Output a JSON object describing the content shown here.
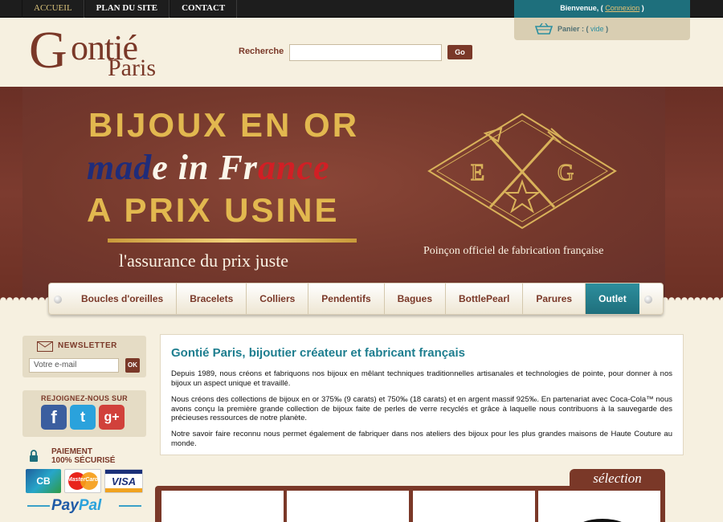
{
  "topnav": {
    "items": [
      {
        "label": "ACCUEIL",
        "active": true
      },
      {
        "label": "PLAN DU SITE",
        "active": false
      },
      {
        "label": "CONTACT",
        "active": false
      }
    ]
  },
  "account": {
    "welcome_prefix": "Bienvenue, (",
    "login_link": "Connexion",
    "welcome_suffix": ")",
    "cart_label": "Panier : (",
    "cart_status": "vide",
    "cart_suffix": ")"
  },
  "logo": {
    "g": "G",
    "ontie": "ontié",
    "paris": "Paris"
  },
  "search": {
    "label": "Recherche",
    "value": "",
    "button": "Go"
  },
  "banner": {
    "line1": "BIJOUX EN OR",
    "line2_part1": "mad",
    "line2_part2": "e in Fr",
    "line2_part3": "ance",
    "line3": "A PRIX USINE",
    "tagline": "l'assurance du prix juste",
    "poincon_text": "Poinçon officiel de fabrication française",
    "poincon_left_letter": "E",
    "poincon_right_letter": "G"
  },
  "categories": [
    {
      "label": "Boucles d'oreilles"
    },
    {
      "label": "Bracelets"
    },
    {
      "label": "Colliers"
    },
    {
      "label": "Pendentifs"
    },
    {
      "label": "Bagues"
    },
    {
      "label": "BottlePearl"
    },
    {
      "label": "Parures"
    },
    {
      "label": "Outlet"
    }
  ],
  "newsletter": {
    "title": "NEWSLETTER",
    "placeholder": "Votre e-mail",
    "button": "OK"
  },
  "social": {
    "title": "REJOIGNEZ-NOUS SUR",
    "facebook": "f",
    "twitter": "t",
    "googleplus": "g+"
  },
  "payment": {
    "title_line1": "PAIEMENT",
    "title_line2": "100% SÉCURISÉ",
    "cb": "CB",
    "mastercard": "MasterCard",
    "visa": "VISA",
    "paypal_a": "Pay",
    "paypal_b": "Pal"
  },
  "content": {
    "heading": "Gontié Paris, bijoutier créateur et fabricant français",
    "paragraphs": [
      "Depuis 1989, nous créons et fabriquons nos bijoux en mêlant techniques traditionnelles artisanales et technologies de pointe, pour donner à nos bijoux un aspect unique et travaillé.",
      "Nous créons des collections de bijoux en or 375‰ (9 carats) et 750‰ (18 carats) et en argent massif 925‰. En partenariat avec Coca-Cola™ nous avons conçu la première grande collection de bijoux faite de perles de verre recyclés et grâce à laquelle nous contribuons à la sauvegarde des précieuses ressources de notre planète.",
      "Notre savoir faire reconnu nous permet également de fabriquer dans nos ateliers des bijoux pour les plus grandes maisons de Haute Couture au monde."
    ]
  },
  "selection": {
    "label": "sélection"
  },
  "colors": {
    "brand": "#7a3828",
    "accent": "#1e7e8f",
    "gold": "#e2b84f",
    "background": "#f6f0e0"
  }
}
